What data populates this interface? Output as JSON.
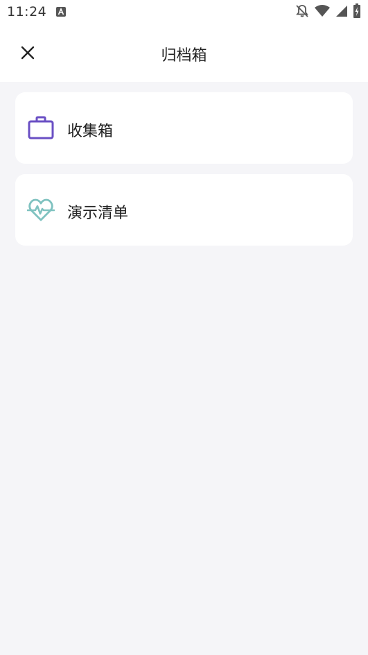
{
  "status_bar": {
    "time": "11:24",
    "icons": [
      "app-notification-icon",
      "bell-off-icon",
      "wifi-icon",
      "signal-icon",
      "battery-icon"
    ]
  },
  "header": {
    "title": "归档箱",
    "close_icon": "close-icon"
  },
  "folders": [
    {
      "label": "收集箱",
      "icon": "briefcase-icon",
      "icon_color": "#6a4fc4"
    },
    {
      "label": "演示清单",
      "icon": "heartbeat-icon",
      "icon_color": "#7fc2c0"
    }
  ],
  "colors": {
    "background": "#f5f5f8",
    "card": "#ffffff",
    "text": "#222222"
  }
}
